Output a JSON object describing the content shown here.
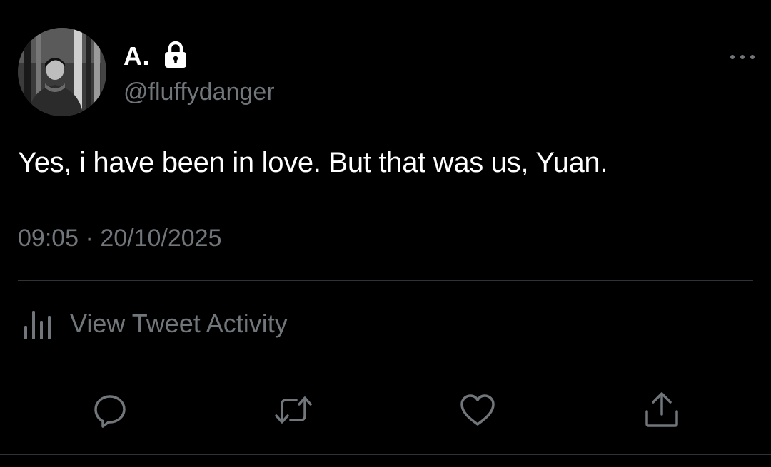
{
  "tweet": {
    "author": {
      "display_name": "A.",
      "handle": "@fluffydanger",
      "protected": true
    },
    "text": "Yes, i have been in love. But that was us, Yuan.",
    "time": "09:05",
    "separator": "·",
    "date": "20/10/2025"
  },
  "activity": {
    "label": "View Tweet Activity"
  },
  "icons": {
    "lock": "lock-icon",
    "more": "more-horizontal-icon",
    "activity": "bar-chart-icon",
    "reply": "reply-icon",
    "retweet": "retweet-icon",
    "like": "heart-icon",
    "share": "share-icon"
  },
  "colors": {
    "background": "#000000",
    "primary_text": "#ffffff",
    "secondary_text": "#71767b",
    "divider": "#2f3336"
  }
}
